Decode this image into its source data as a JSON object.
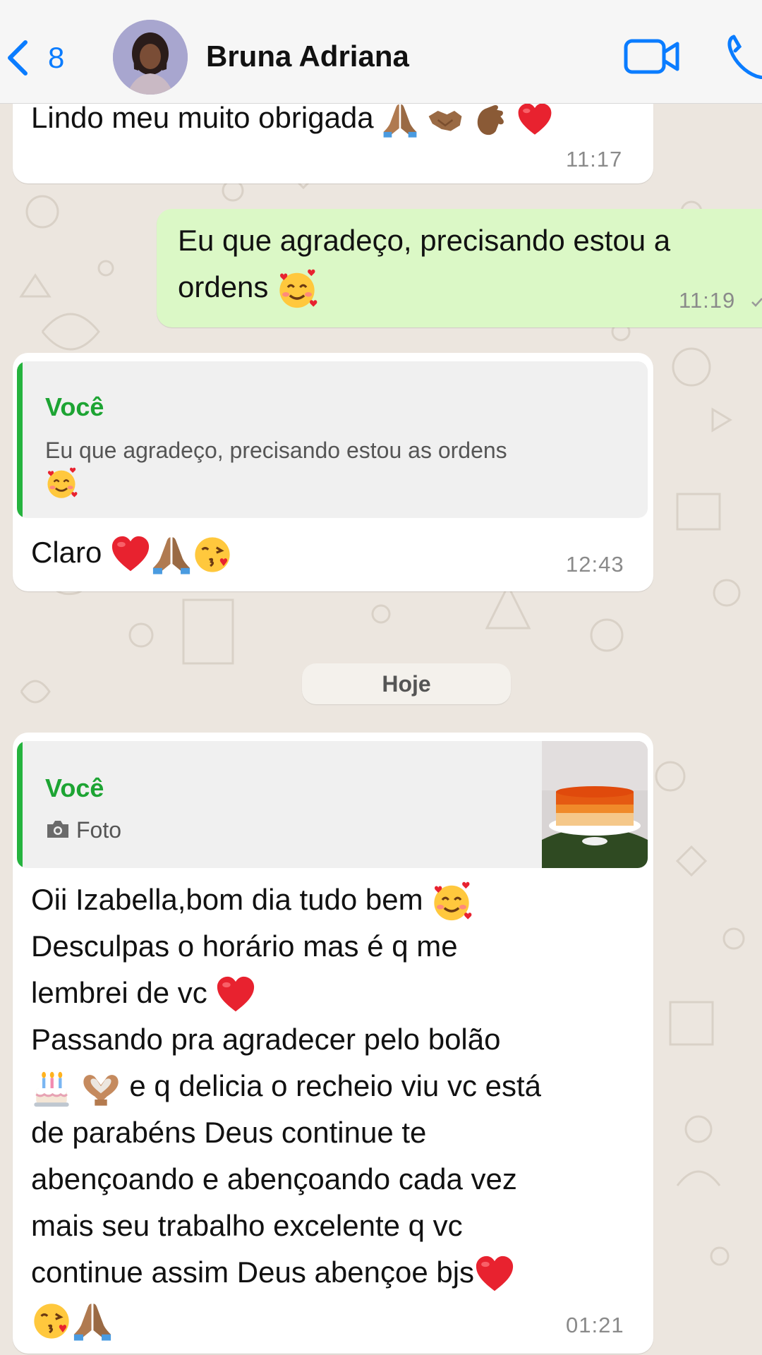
{
  "header": {
    "back_count": "8",
    "contact_name": "Bruna Adriana",
    "accent_color": "#0a7cff"
  },
  "messages": {
    "m1": {
      "text": "Lindo meu muito obrigada",
      "time": "11:17"
    },
    "m2": {
      "line1": "Eu que agradeço, precisando estou a",
      "line2": "ordens",
      "time": "11:19"
    },
    "m3": {
      "quote_author": "Você",
      "quote_text": "Eu que agradeço, precisando estou as ordens",
      "text": "Claro",
      "time": "12:43"
    },
    "date_separator": "Hoje",
    "m4": {
      "quote_author": "Você",
      "quote_media": "Foto",
      "lines": [
        "Oii Izabella,bom dia tudo bem",
        "Desculpas o horário mas é q me",
        "lembrei de vc",
        "Passando pra agradecer pelo bolão",
        "e q delicia o recheio viu vc está",
        "de parabéns Deus continue te",
        "abençoando e abençoando cada vez",
        "mais seu trabalho excelente q vc",
        "continue assim Deus abençoe bjs"
      ],
      "time": "01:21"
    }
  },
  "icons": [
    "chevron-left-icon",
    "video-call-icon",
    "phone-icon",
    "camera-icon",
    "heart-emoji",
    "pray-emoji",
    "smiling-hearts-emoji",
    "kiss-emoji",
    "cake-emoji",
    "heart-hands-emoji"
  ],
  "colors": {
    "incoming_bubble": "#ffffff",
    "outgoing_bubble": "#dbf8c6",
    "quote_accent": "#25b33e",
    "background": "#ece6df"
  }
}
